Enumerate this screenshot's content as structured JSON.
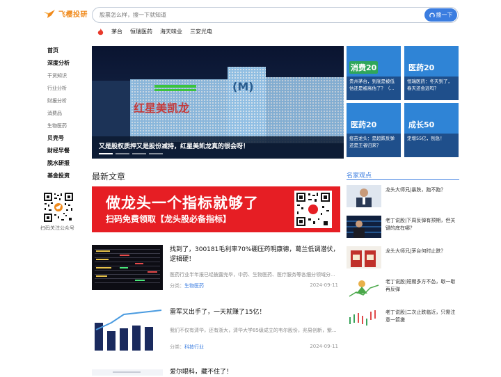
{
  "brand": {
    "name": "飞樱投研"
  },
  "search": {
    "placeholder": "股票怎么样，搜一下就知道",
    "button_label": "搜一下"
  },
  "hot_stocks": [
    "茅台",
    "恒瑞医药",
    "海天味业",
    "三安光电"
  ],
  "sidebar": {
    "items": [
      {
        "label": "首页",
        "kind": "major"
      },
      {
        "label": "深度分析",
        "kind": "major"
      },
      {
        "label": "干货知识",
        "kind": "minor"
      },
      {
        "label": "行业分析",
        "kind": "minor"
      },
      {
        "label": "财报分析",
        "kind": "minor"
      },
      {
        "label": "消费品",
        "kind": "minor"
      },
      {
        "label": "生物医药",
        "kind": "minor"
      },
      {
        "label": "贝壳号",
        "kind": "major"
      },
      {
        "label": "财经早餐",
        "kind": "major"
      },
      {
        "label": "脱水研报",
        "kind": "major"
      },
      {
        "label": "基金投资",
        "kind": "major"
      }
    ],
    "qr_caption": "扫码关注公众号"
  },
  "hero": {
    "caption": "又是股权质押又是股份减持，红星美凯龙真的很会呀！"
  },
  "tiles": [
    {
      "badge": "消费20",
      "badge_color": "#2fa65a",
      "text": "贵州茅台，到底是被低估还是被高估了？（..."
    },
    {
      "badge": "医药20",
      "badge_color": "#2f84d6",
      "text": "恒瑞医药：冬天到了，春天还会远吗？"
    },
    {
      "badge": "医药20",
      "badge_color": "#2f84d6",
      "text": "疫苗龙头：是超跌反弹还是王者归来？"
    },
    {
      "badge": "成长50",
      "badge_color": "#2f84d6",
      "text": "定增55亿，别急！"
    }
  ],
  "latest": {
    "title": "最新文章"
  },
  "banner": {
    "headline": "做龙头一个指标就够了",
    "subline": "扫码免费领取【龙头股必备指标】"
  },
  "articles": [
    {
      "title": "找到了，300181毛利率70%硼压药明康德，葛兰低调潜伏，逻辑硬！",
      "excerpt": "医药行业半年报已经披露完毕，中药、生物医药、医疗服务等各细分领域分...",
      "category_label": "分类：",
      "category": "生物医药",
      "date": "2024-09-11"
    },
    {
      "title": "雷军又出手了，一天就赚了15亿！",
      "excerpt": "我们不仅有清华，还有浙大，清华大学85级成立的韦尔股份，兆易创新，紫...",
      "category_label": "分类：",
      "category": "科技行业",
      "date": "2024-09-11"
    },
    {
      "title": "爱尔眼科，藏不住了！",
      "excerpt": "",
      "category_label": "",
      "category": "",
      "date": ""
    }
  ],
  "experts": {
    "title": "名家观点",
    "items": [
      {
        "text": "龙头大师兄|暴跌，跑不跑？"
      },
      {
        "text": "老丁说股|下周反弹有预期，但关键的底在哪？"
      },
      {
        "text": "龙头大师兄|茅台何时止跌？"
      },
      {
        "text": "老丁说股|短期多方不怂，歇一歇再反弹"
      },
      {
        "text": "老丁说股|二次止跌临近，只需注意一箭搓"
      }
    ]
  }
}
